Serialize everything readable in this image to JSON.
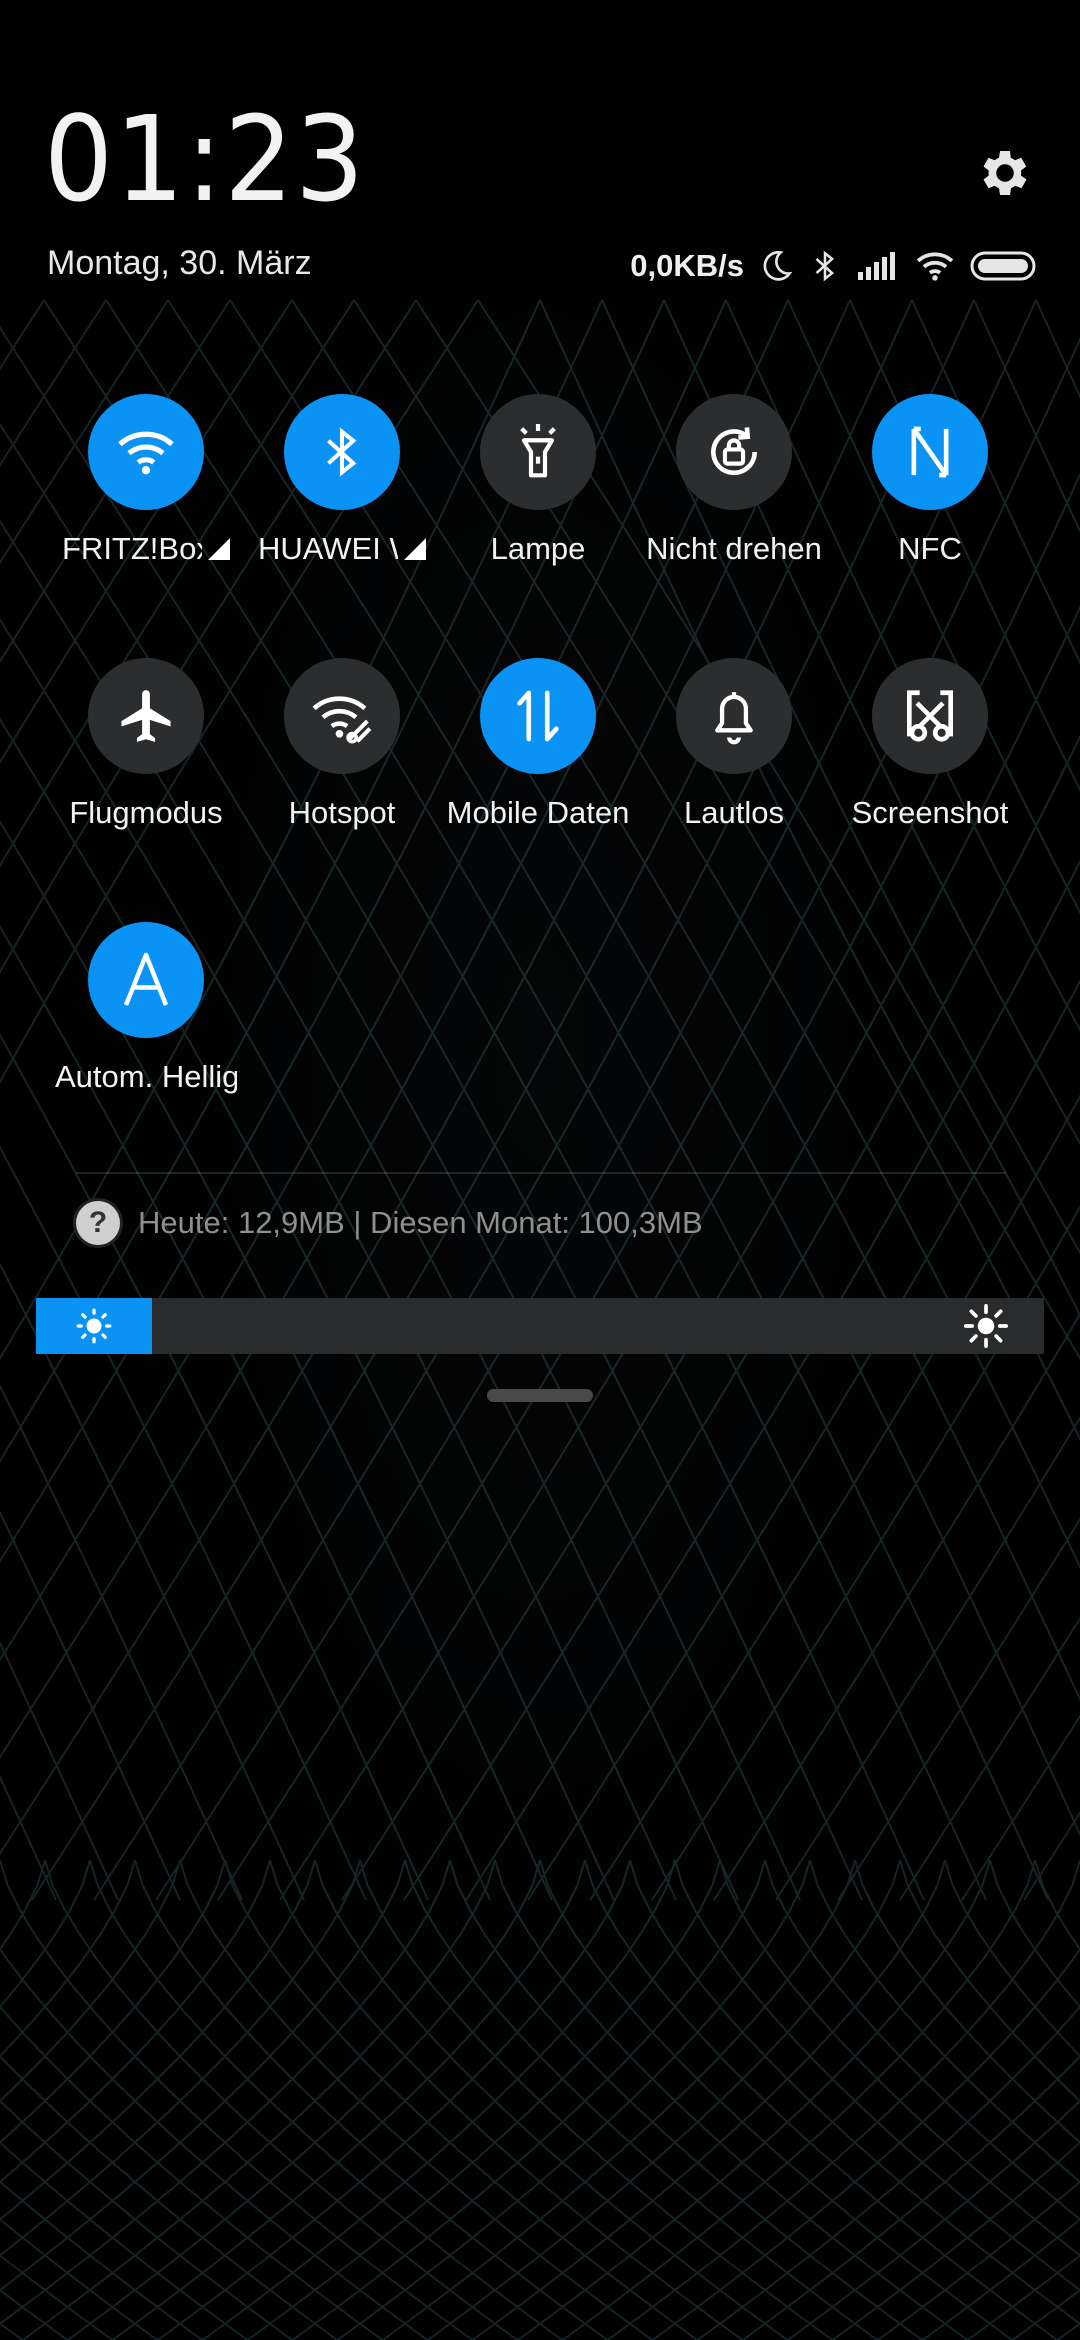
{
  "header": {
    "time": "01:23",
    "date": "Montag, 30. März",
    "net_speed": "0,0KB/s"
  },
  "status_icons": [
    "moon-icon",
    "bluetooth-icon",
    "signal-icon",
    "wifi-icon",
    "battery-icon"
  ],
  "tiles": [
    {
      "label": "FRITZ!Box",
      "icon": "wifi-icon",
      "active": true,
      "has_arrow": true
    },
    {
      "label": "HUAWEI W",
      "icon": "bluetooth-icon",
      "active": true,
      "has_arrow": true
    },
    {
      "label": "Lampe",
      "icon": "flashlight-icon",
      "active": false
    },
    {
      "label": "Nicht drehen",
      "icon": "rotation-lock-icon",
      "active": false
    },
    {
      "label": "NFC",
      "icon": "nfc-icon",
      "active": true
    },
    {
      "label": "Flugmodus",
      "icon": "airplane-icon",
      "active": false
    },
    {
      "label": "Hotspot",
      "icon": "hotspot-icon",
      "active": false
    },
    {
      "label": "Mobile Daten",
      "icon": "mobile-data-icon",
      "active": true
    },
    {
      "label": "Lautlos",
      "icon": "bell-icon",
      "active": false
    },
    {
      "label": "Screenshot",
      "icon": "screenshot-icon",
      "active": false
    },
    {
      "label": "Autom. Helligkeit",
      "icon": "auto-brightness-icon",
      "active": true
    }
  ],
  "data_usage": {
    "text": "Heute: 12,9MB | Diesen Monat: 100,3MB",
    "icon": "help-icon"
  },
  "brightness": {
    "level": 0.115
  },
  "colors": {
    "accent": "#0a93f5",
    "tile_off": "#2c2d2f",
    "background": "#000000"
  }
}
